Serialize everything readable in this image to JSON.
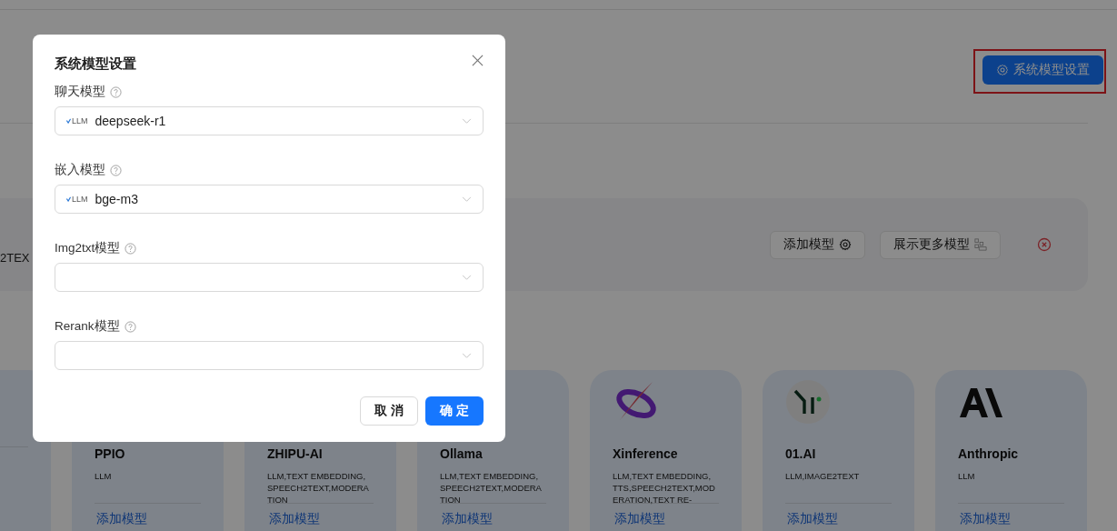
{
  "header": {
    "settings_button": "系统模型设置"
  },
  "provider_panel": {
    "tags_fragment": "2TEX",
    "buttons": [
      "添加模型",
      "展示更多模型"
    ]
  },
  "providers": [
    {
      "kind": "covered"
    },
    {
      "name": "PPIO",
      "tags": "LLM",
      "link": "添加模型",
      "kind": "covered"
    },
    {
      "name": "ZHIPU-AI",
      "tags": "LLM,TEXT EMBEDDING,SPEECH2TEXT,MODERATION",
      "link": "添加模型",
      "kind": "covered"
    },
    {
      "name": "Ollama",
      "tags": "LLM,TEXT EMBEDDING,SPEECH2TEXT,MODERATION",
      "link": "添加模型",
      "kind": "covered"
    },
    {
      "name": "Xinference",
      "tags": "LLM,TEXT EMBEDDING,TTS,SPEECH2TEXT,MODERATION,TEXT RE-",
      "link": "添加模型",
      "kind": "swoosh"
    },
    {
      "name": "01.AI",
      "tags": "LLM,IMAGE2TEXT",
      "link": "添加模型",
      "kind": "yi"
    },
    {
      "name": "Anthropic",
      "tags": "LLM",
      "link": "添加模型",
      "kind": "letters"
    }
  ],
  "dialog": {
    "title": "系统模型设置",
    "fields": [
      {
        "label": "聊天模型",
        "value": "deepseek-r1",
        "badge": "LLM"
      },
      {
        "label": "嵌入模型",
        "value": "bge-m3",
        "badge": "LLM"
      },
      {
        "label": "Img2txt模型"
      },
      {
        "label": "Rerank模型"
      }
    ],
    "buttons": [
      {
        "label": "取 消",
        "kind": "secondary"
      },
      {
        "label": "确 定",
        "kind": "primary"
      }
    ]
  }
}
